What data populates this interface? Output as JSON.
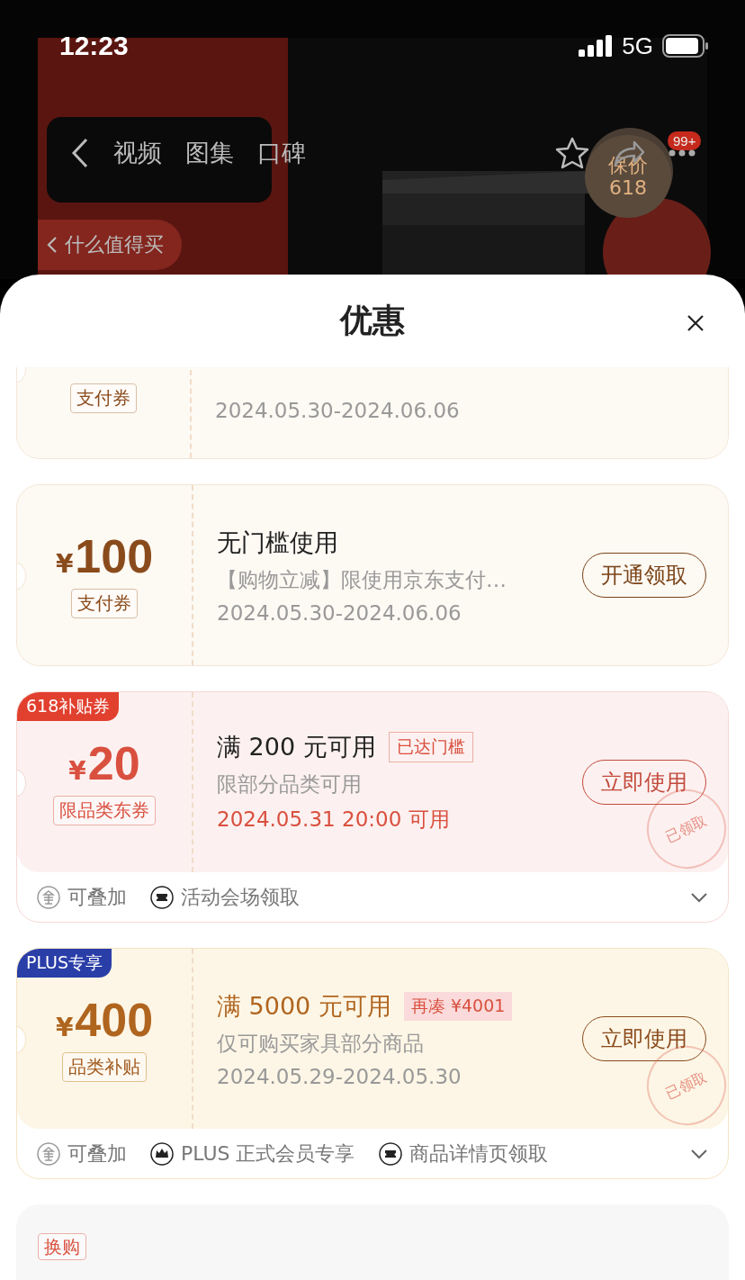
{
  "status_bar": {
    "time": "12:23",
    "network": "5G"
  },
  "background_page": {
    "nav_tabs": [
      "视频",
      "图集",
      "口碑"
    ],
    "cart_badge": "99+",
    "price_badge": [
      "保价",
      "618"
    ],
    "return_link": "什么值得买"
  },
  "sheet": {
    "title": "优惠"
  },
  "coupons": [
    {
      "kind": "brown",
      "type_label": "支付券",
      "date": "2024.05.30-2024.06.06"
    },
    {
      "kind": "brown",
      "currency": "¥",
      "amount": "100",
      "type_label": "支付券",
      "title": "无门槛使用",
      "description": "【购物立减】限使用京东支付…",
      "date": "2024.05.30-2024.06.06",
      "button": "开通领取"
    },
    {
      "kind": "red",
      "badge": {
        "text": "618补贴券",
        "kind": "red"
      },
      "currency": "¥",
      "amount": "20",
      "type_label": "限品类东券",
      "title": "满 200 元可用",
      "threshold": {
        "text": "已达门槛",
        "kind": "reached"
      },
      "description": "限部分品类可用",
      "date": "2024.05.31 20:00 可用",
      "button": "立即使用",
      "stamp": "已领取",
      "expanded": false,
      "footer": [
        {
          "kind": "stack",
          "text": "可叠加"
        },
        {
          "kind": "ticket",
          "text": "活动会场领取"
        }
      ]
    },
    {
      "kind": "gold",
      "badge": {
        "text": "PLUS专享",
        "kind": "plus"
      },
      "currency": "¥",
      "amount": "400",
      "type_label": "品类补贴",
      "title": "满 5000 元可用",
      "threshold": {
        "text": "再凑 ¥4001",
        "kind": "short"
      },
      "description": "仅可购买家具部分商品",
      "date": "2024.05.29-2024.05.30",
      "button": "立即使用",
      "stamp": "已领取",
      "expanded": false,
      "footer": [
        {
          "kind": "stack",
          "text": "可叠加"
        },
        {
          "kind": "crown",
          "text": "PLUS 正式会员专享"
        },
        {
          "kind": "ticket",
          "text": "商品详情页领取"
        }
      ]
    }
  ],
  "trade_in": {
    "tag": "换购"
  }
}
